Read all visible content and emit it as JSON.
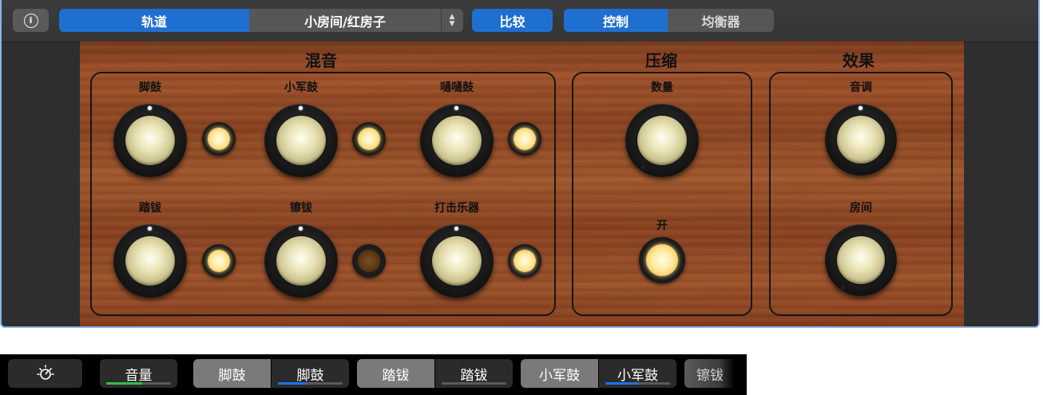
{
  "toolbar": {
    "info_icon": "info-icon",
    "info_glyph": "i",
    "view_tab": "轨道",
    "preset": "小房间/红房子",
    "compare": "比较",
    "tabs": [
      "控制",
      "均衡器"
    ],
    "accent_color": "#1f6fd1"
  },
  "mix": {
    "title": "混音",
    "channels": [
      {
        "label": "脚鼓",
        "led": "on"
      },
      {
        "label": "小军鼓",
        "led": "on"
      },
      {
        "label": "嗵嗵鼓",
        "led": "on"
      },
      {
        "label": "踏钹",
        "led": "on"
      },
      {
        "label": "镲钹",
        "led": "off"
      },
      {
        "label": "打击乐器",
        "led": "on"
      }
    ]
  },
  "compressor": {
    "title": "压缩",
    "amount_label": "数量",
    "on_label": "开",
    "on_state": "on"
  },
  "effects": {
    "title": "效果",
    "tone_label": "音调",
    "room_label": "房间"
  },
  "touchbar": {
    "gear_icon": "brightness-gear-icon",
    "volume": {
      "label": "音量",
      "level": 0.55,
      "color": "#2fc14a"
    },
    "pairs": [
      {
        "name_label": "脚鼓",
        "control_label": "脚鼓",
        "level": 0.45
      },
      {
        "name_label": "踏钹",
        "control_label": "踏钹",
        "level": 0.0
      },
      {
        "name_label": "小军鼓",
        "control_label": "小军鼓",
        "level": 0.5
      }
    ],
    "level_color": "#1f72e8",
    "overflow_label": "镲钹"
  }
}
